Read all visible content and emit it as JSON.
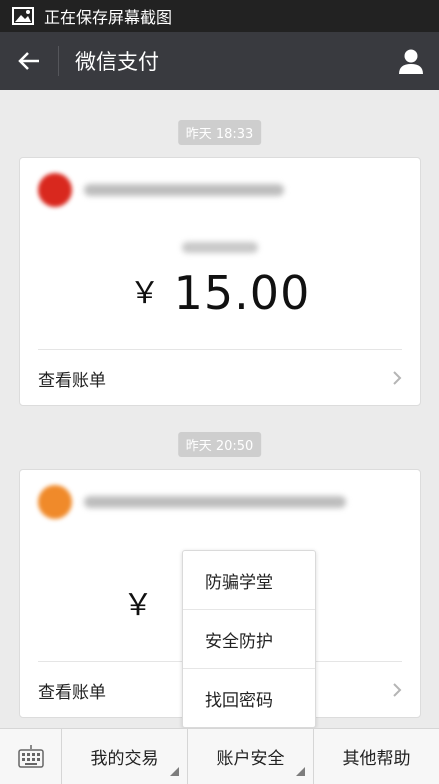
{
  "status_bar": {
    "text": "正在保存屏幕截图",
    "icon": "image-icon"
  },
  "header": {
    "title": "微信支付",
    "back_icon": "back-arrow-icon",
    "profile_icon": "profile-icon"
  },
  "messages": [
    {
      "time": "昨天 18:33",
      "amount_currency": "￥",
      "amount_value": "15.00",
      "bill_label": "查看账单",
      "logo_color": "#d9281e"
    },
    {
      "time": "昨天 20:50",
      "amount_currency": "￥",
      "amount_value": "",
      "bill_label": "查看账单",
      "logo_color": "#f08a2a"
    }
  ],
  "bottom_menu": {
    "keyboard_icon": "keyboard-icon",
    "tabs": [
      "我的交易",
      "账户安全",
      "其他帮助"
    ]
  },
  "popup_menu": {
    "items": [
      "防骗学堂",
      "安全防护",
      "找回密码"
    ]
  },
  "colors": {
    "title_bar": "#393a3f",
    "status_bar": "#222222",
    "background": "#ebebeb"
  }
}
